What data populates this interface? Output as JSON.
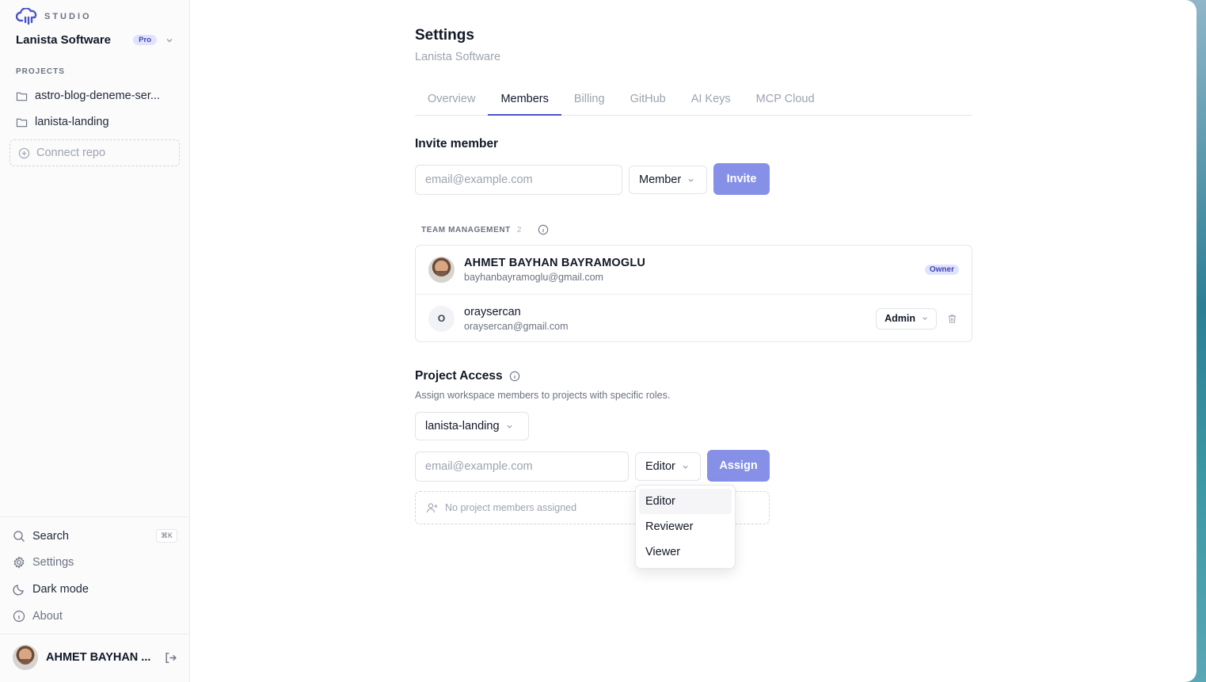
{
  "sidebar": {
    "brand_word": "STUDIO",
    "workspace_name": "Lanista Software",
    "plan_badge": "Pro",
    "projects_label": "PROJECTS",
    "projects": [
      {
        "label": "astro-blog-deneme-ser..."
      },
      {
        "label": "lanista-landing"
      }
    ],
    "connect_repo_label": "Connect repo",
    "bottom_items": {
      "search": "Search",
      "search_shortcut": "⌘K",
      "settings": "Settings",
      "dark_mode": "Dark mode",
      "about": "About"
    },
    "user_name": "AHMET BAYHAN ..."
  },
  "page": {
    "title": "Settings",
    "subtitle": "Lanista Software"
  },
  "tabs": [
    {
      "label": "Overview",
      "active": false
    },
    {
      "label": "Members",
      "active": true
    },
    {
      "label": "Billing",
      "active": false
    },
    {
      "label": "GitHub",
      "active": false
    },
    {
      "label": "AI Keys",
      "active": false
    },
    {
      "label": "MCP Cloud",
      "active": false
    }
  ],
  "invite": {
    "title": "Invite member",
    "email_placeholder": "email@example.com",
    "role_value": "Member",
    "button_label": "Invite"
  },
  "team": {
    "label": "TEAM MANAGEMENT",
    "count": "2",
    "members": [
      {
        "name": "AHMET BAYHAN BAYRAMOGLU",
        "email": "bayhanbayramoglu@gmail.com",
        "role_badge": "Owner"
      },
      {
        "initial": "O",
        "name": "oraysercan",
        "email": "oraysercan@gmail.com",
        "role": "Admin"
      }
    ]
  },
  "project_access": {
    "title": "Project Access",
    "description": "Assign workspace members to projects with specific roles.",
    "project_select": "lanista-landing",
    "email_placeholder": "email@example.com",
    "role_value": "Editor",
    "button_label": "Assign",
    "empty_text": "No project members assigned",
    "role_options": [
      "Editor",
      "Reviewer",
      "Viewer"
    ]
  },
  "colors": {
    "accent": "#4b54c7",
    "button": "#8590e6",
    "badge_bg": "#e0e3fb"
  }
}
